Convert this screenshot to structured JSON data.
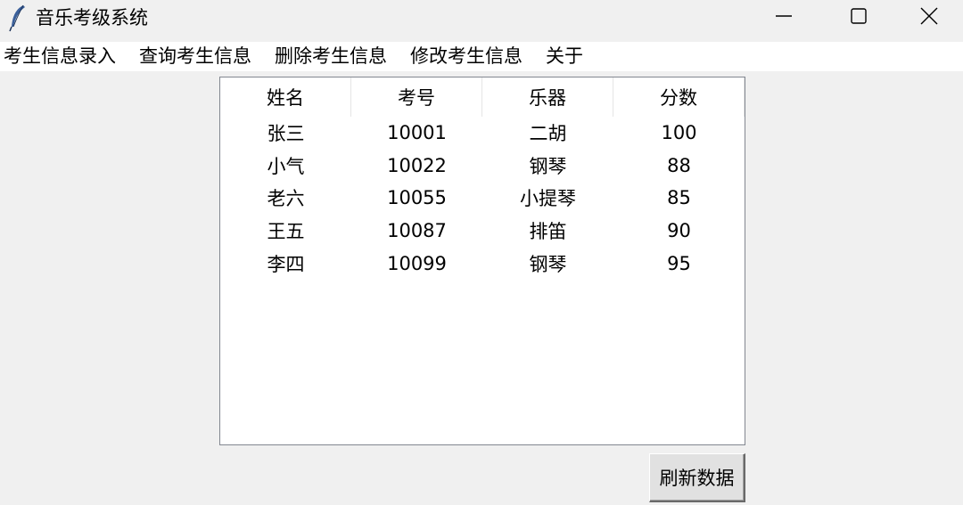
{
  "window": {
    "title": "音乐考级系统",
    "icon": "feather-icon"
  },
  "controls": {
    "minimize_icon": "minimize-icon",
    "maximize_icon": "maximize-icon",
    "close_icon": "close-icon"
  },
  "menu": {
    "items": [
      {
        "label": "考生信息录入"
      },
      {
        "label": "查询考生信息"
      },
      {
        "label": "删除考生信息"
      },
      {
        "label": "修改考生信息"
      },
      {
        "label": "关于"
      }
    ]
  },
  "table": {
    "columns": [
      "姓名",
      "考号",
      "乐器",
      "分数"
    ],
    "rows": [
      [
        "张三",
        "10001",
        "二胡",
        "100"
      ],
      [
        "小气",
        "10022",
        "钢琴",
        "88"
      ],
      [
        "老六",
        "10055",
        "小提琴",
        "85"
      ],
      [
        "王五",
        "10087",
        "排笛",
        "90"
      ],
      [
        "李四",
        "10099",
        "钢琴",
        "95"
      ]
    ]
  },
  "buttons": {
    "refresh_label": "刷新数据"
  },
  "colors": {
    "background": "#f0f0f0",
    "menubar": "#ffffff",
    "table_background": "#ffffff",
    "table_border": "#828790",
    "button_face": "#e1e1e1"
  }
}
